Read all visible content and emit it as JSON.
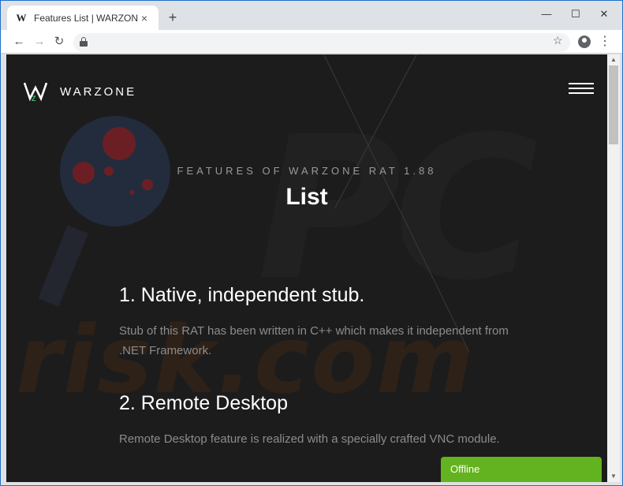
{
  "browser": {
    "tab_title": "Features List | WARZONE",
    "tab_favicon": "W",
    "tab_close": "×",
    "new_tab": "+",
    "window_controls": {
      "minimize": "—",
      "maximize": "☐",
      "close": "✕"
    },
    "nav": {
      "back": "←",
      "forward": "→",
      "reload": "↻"
    },
    "star": "☆",
    "menu": "⋮"
  },
  "site": {
    "logo_text": "WARZONE",
    "subtitle": "FEATURES OF WARZONE RAT 1.88",
    "title": "List",
    "features": [
      {
        "heading": "1. Native, independent stub.",
        "description": "Stub of this RAT has been written in C++ which makes it independent from .NET Framework."
      },
      {
        "heading": "2. Remote Desktop",
        "description": "Remote Desktop feature is realized with a specially crafted VNC module."
      }
    ],
    "status_badge": "Offline"
  },
  "watermark": {
    "text": "risk.com",
    "letters": "PC"
  },
  "colors": {
    "page_bg": "#1c1c1c",
    "badge": "#63b21f",
    "heading": "#ffffff",
    "desc": "#8c8c8c",
    "frame": "#1f6fc8"
  },
  "scrollbar": {
    "up": "▲",
    "down": "▼"
  }
}
